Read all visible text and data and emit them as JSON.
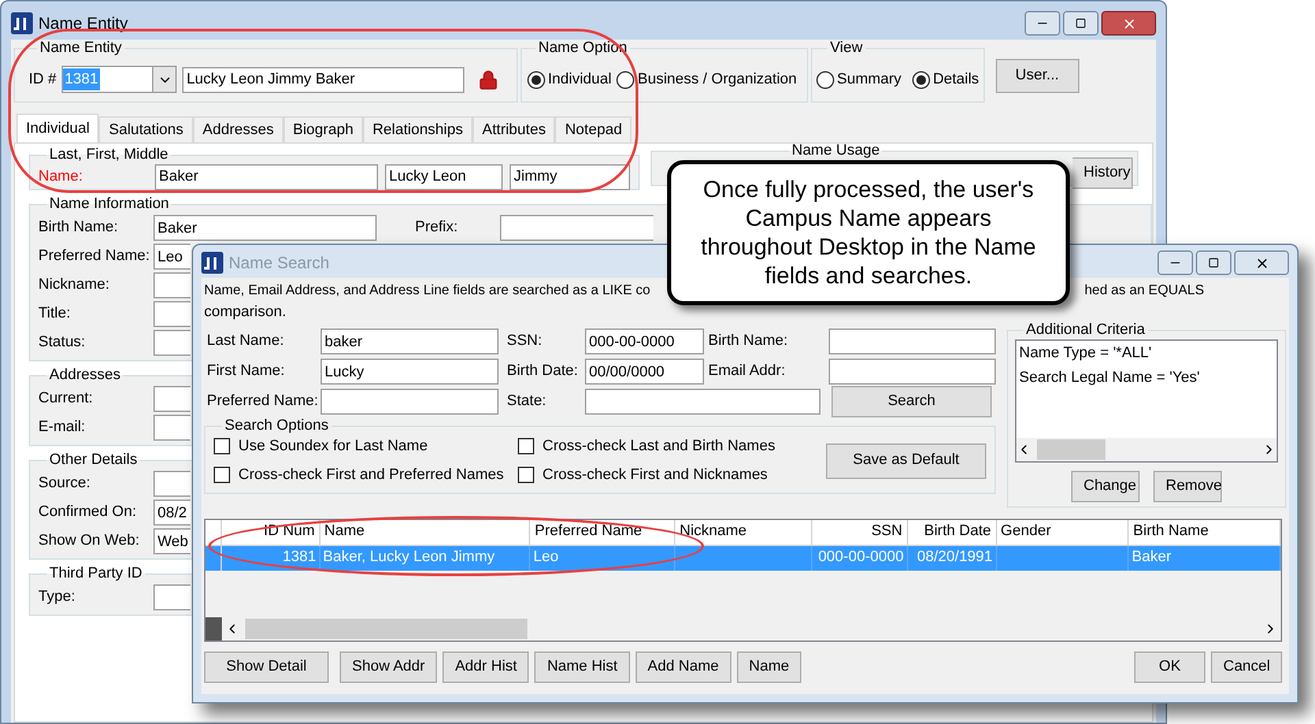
{
  "main_window": {
    "title": "Name Entity",
    "name_entity": {
      "legend": "Name Entity",
      "id_label": "ID #",
      "id_value": "1381",
      "full_name": "Lucky Leon Jimmy Baker"
    },
    "name_option": {
      "legend": "Name Option",
      "options": [
        {
          "label": "Individual",
          "selected": true
        },
        {
          "label": "Business / Organization",
          "selected": false
        }
      ]
    },
    "view": {
      "legend": "View",
      "options": [
        {
          "label": "Summary",
          "selected": false
        },
        {
          "label": "Details",
          "selected": true
        }
      ]
    },
    "user_button": "User...",
    "tabs": [
      {
        "label": "Individual",
        "selected": true
      },
      {
        "label": "Salutations",
        "selected": false
      },
      {
        "label": "Addresses",
        "selected": false
      },
      {
        "label": "Biograph",
        "selected": false
      },
      {
        "label": "Relationships",
        "selected": false
      },
      {
        "label": "Attributes",
        "selected": false
      },
      {
        "label": "Notepad",
        "selected": false
      }
    ],
    "name_group": {
      "legend": "Last, First, Middle",
      "label": "Name:",
      "last": "Baker",
      "first": "Lucky Leon",
      "middle": "Jimmy"
    },
    "name_usage": {
      "legend": "Name Usage",
      "history_button": "History"
    },
    "prefix_label": "Prefix:",
    "groups": [
      {
        "legend": "Name Information",
        "fields": [
          {
            "label": "Birth Name:",
            "value": "Baker"
          },
          {
            "label": "Preferred Name:",
            "value": "Leo"
          },
          {
            "label": "Nickname:"
          },
          {
            "label": "Title:"
          },
          {
            "label": "Status:"
          }
        ]
      },
      {
        "legend": "Addresses",
        "fields": [
          {
            "label": "Current:"
          },
          {
            "label": "E-mail:"
          }
        ]
      },
      {
        "legend": "Other Details",
        "fields": [
          {
            "label": "Source:"
          },
          {
            "label": "Confirmed On:",
            "value": "08/2"
          },
          {
            "label": "Show On Web:",
            "value": "Web"
          }
        ]
      },
      {
        "legend": "Third Party ID",
        "fields": [
          {
            "label": "Type:"
          }
        ]
      }
    ]
  },
  "callout": {
    "text": "Once fully processed, the user's\nCampus Name appears\nthroughout Desktop in the Name\nfields and searches."
  },
  "search_dialog": {
    "title": "Name Search",
    "description": {
      "line_start": "Name, Email Address, and Address Line fields are searched as a LIKE co",
      "line_end": "hed as an EQUALS",
      "line_2": "comparison."
    },
    "field_rows": [
      [
        {
          "label": "Last Name:",
          "value": "baker"
        },
        {
          "label": "SSN:",
          "value": "000-00-0000"
        },
        {
          "label": "Birth Name:"
        }
      ],
      [
        {
          "label": "First Name:",
          "value": "Lucky"
        },
        {
          "label": "Birth Date:",
          "value": "00/00/0000"
        },
        {
          "label": "Email Addr:"
        }
      ],
      [
        {
          "label": "Preferred Name:"
        },
        {
          "label": "State:"
        }
      ]
    ],
    "search_button": "Search",
    "search_options": {
      "legend": "Search Options",
      "options": [
        {
          "label": "Use Soundex for Last Name",
          "checked": false
        },
        {
          "label": "Cross-check Last and Birth Names",
          "checked": false
        },
        {
          "label": "Cross-check First and Preferred Names",
          "checked": false
        },
        {
          "label": "Cross-check First and Nicknames",
          "checked": false
        }
      ]
    },
    "save_default_button": "Save as Default",
    "additional_criteria": {
      "legend": "Additional Criteria",
      "items": [
        "Name Type = '*ALL'",
        "Search Legal Name = 'Yes'"
      ],
      "buttons": [
        "Change",
        "Remove"
      ]
    },
    "table": {
      "columns": [
        "ID Num",
        "Name",
        "Preferred Name",
        "Nickname",
        "SSN",
        "Birth Date",
        "Gender",
        "Birth Name"
      ],
      "rows": [
        {
          "selected": true,
          "cells": [
            "1381",
            "Baker, Lucky Leon Jimmy",
            "Leo",
            "",
            "000-00-0000",
            "08/20/1991",
            "",
            "Baker"
          ]
        }
      ]
    },
    "buttons": [
      "Show Detail",
      "Show Addr",
      "Addr Hist",
      "Name Hist",
      "Add Name",
      "Name"
    ],
    "dialog_buttons": [
      "OK",
      "Cancel"
    ]
  }
}
